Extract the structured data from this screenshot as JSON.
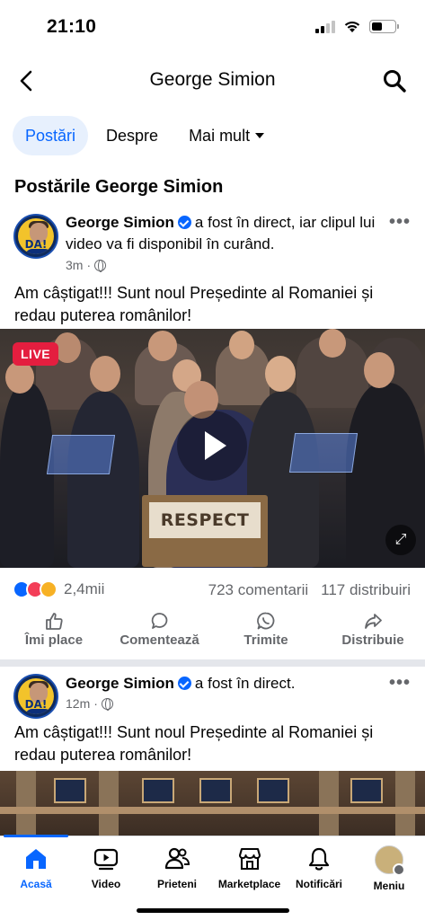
{
  "status_bar": {
    "time": "21:10",
    "battery_level": 0.45
  },
  "nav": {
    "title": "George Simion",
    "back_icon": "chevron-left-icon",
    "search_icon": "search-icon"
  },
  "tabs": [
    {
      "label": "Postări",
      "active": true
    },
    {
      "label": "Despre",
      "active": false
    },
    {
      "label": "Mai mult",
      "active": false
    }
  ],
  "section_title": "Postările George Simion",
  "posts": [
    {
      "author": "George Simion",
      "action": "a fost în direct, iar clipul lui video va fi disponibil în curând.",
      "time": "3m",
      "text": "Am câștigat!!! Sunt noul Președinte al Romaniei și redau puterea românilor!",
      "live_label": "LIVE",
      "podium_text": "RESPECT",
      "reaction_count": "2,4mii",
      "comments": "723 comentarii",
      "shares": "117 distribuiri",
      "actions": [
        "Îmi place",
        "Comentează",
        "Trimite",
        "Distribuie"
      ]
    },
    {
      "author": "George Simion",
      "action": "a fost în direct.",
      "time": "12m",
      "text": "Am câștigat!!! Sunt noul Președinte al Romaniei și redau puterea românilor!"
    }
  ],
  "avatar_text": "DA!",
  "bottom_tabs": [
    {
      "label": "Acasă",
      "icon": "home-icon",
      "active": true
    },
    {
      "label": "Video",
      "icon": "video-icon",
      "active": false
    },
    {
      "label": "Prieteni",
      "icon": "friends-icon",
      "active": false
    },
    {
      "label": "Marketplace",
      "icon": "marketplace-icon",
      "active": false
    },
    {
      "label": "Notificări",
      "icon": "bell-icon",
      "active": false
    },
    {
      "label": "Meniu",
      "icon": "menu-avatar-icon",
      "active": false
    }
  ],
  "colors": {
    "accent": "#0866ff",
    "live": "#e41e3f",
    "muted": "#65676b"
  }
}
